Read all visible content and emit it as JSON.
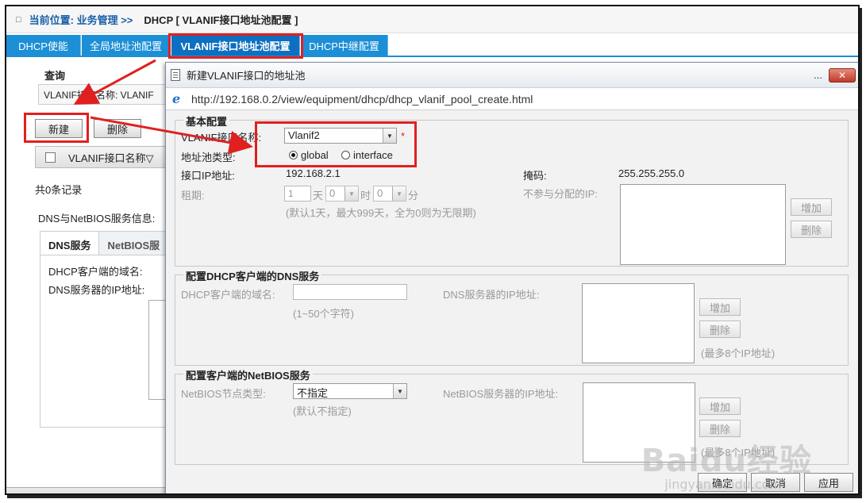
{
  "location": {
    "square_glyph": "□",
    "label": "当前位置: 业务管理 >>",
    "crumb": "DHCP [ VLANIF接口地址池配置 ]"
  },
  "tabs": [
    {
      "label": "DHCP使能"
    },
    {
      "label": "全局地址池配置"
    },
    {
      "label": "VLANIF接口地址池配置"
    },
    {
      "label": "DHCP中继配置"
    }
  ],
  "left_page": {
    "query_title": "查询",
    "query_field_label": "VLANIF接口名称: VLANIF",
    "new_button": "新建",
    "delete_button": "删除",
    "table_column": "VLANIF接口名称▽",
    "record_count": "共0条记录",
    "dns_netbios_info": "DNS与NetBIOS服务信息:",
    "subtab_dns": "DNS服务",
    "subtab_netbios": "NetBIOS服",
    "dhcp_client_domain_label": "DHCP客户端的域名:",
    "dns_server_ip_label": "DNS服务器的IP地址:"
  },
  "dialog": {
    "title": "新建VLANIF接口的地址池",
    "dots": "...",
    "close_glyph": "✕",
    "url": "http://192.168.0.2/view/equipment/dhcp/dhcp_vlanif_pool_create.html",
    "basic": {
      "legend": "基本配置",
      "vlanif_name_label": "VLANIF接口名称:",
      "vlanif_value": "Vlanif2",
      "required_mark": "*",
      "pool_type_label": "地址池类型:",
      "radio_global": "global",
      "radio_interface": "interface",
      "interface_ip_label": "接口IP地址:",
      "interface_ip_value": "192.168.2.1",
      "mask_label": "掩码:",
      "mask_value": "255.255.255.0",
      "lease_label": "租期:",
      "lease_days": "1",
      "unit_day": "天",
      "lease_hours": "0",
      "unit_hour": "时",
      "lease_minutes": "0",
      "unit_minute": "分",
      "lease_hint": "(默认1天，最大999天，全为0则为无限期)",
      "excluded_ip_label": "不参与分配的IP:",
      "add_button": "增加",
      "delete_button": "删除"
    },
    "dns": {
      "legend": "配置DHCP客户端的DNS服务",
      "domain_label": "DHCP客户端的域名:",
      "domain_hint": "(1~50个字符)",
      "dns_ip_label": "DNS服务器的IP地址:",
      "add_button": "增加",
      "delete_button": "删除",
      "max_hint": "(最多8个IP地址)"
    },
    "netbios": {
      "legend": "配置客户端的NetBIOS服务",
      "node_type_label": "NetBIOS节点类型:",
      "node_type_value": "不指定",
      "node_type_hint": "(默认不指定)",
      "netbios_ip_label": "NetBIOS服务器的IP地址:",
      "add_button": "增加",
      "delete_button": "删除",
      "max_hint": "(最多8个IP地址)"
    },
    "footer": {
      "ok": "确定",
      "cancel": "取消",
      "apply": "应用"
    }
  },
  "watermark": {
    "main": "Baidu经验",
    "sub": "jingyan.baidu.com"
  },
  "colors": {
    "tab_blue": "#1c8fd6",
    "highlight_red": "#e02020",
    "link_blue": "#1a5fa8"
  }
}
